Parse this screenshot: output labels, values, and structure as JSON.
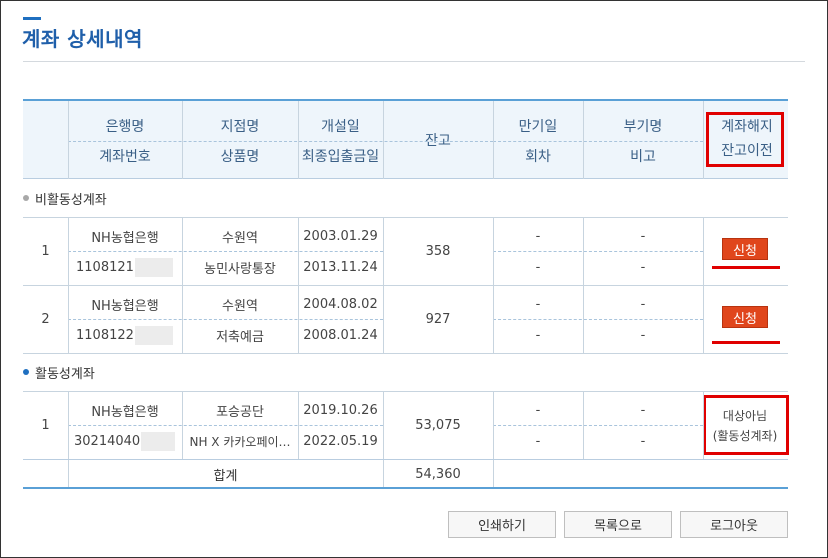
{
  "page": {
    "title": "계좌 상세내역"
  },
  "header": {
    "bank": "은행명",
    "account_no": "계좌번호",
    "branch": "지점명",
    "product": "상품명",
    "open_date": "개설일",
    "last_tx": "최종입출금일",
    "balance": "잔고",
    "maturity": "만기일",
    "round": "회차",
    "sub_name": "부기명",
    "remark": "비고",
    "action_line1": "계좌해지",
    "action_line2": "잔고이전"
  },
  "sections": {
    "inactive": {
      "label": "비활동성계좌",
      "color": "#a8a8a8"
    },
    "active": {
      "label": "활동성계좌",
      "color": "#1f6fc0"
    }
  },
  "rows": [
    {
      "no": "1",
      "bank": "NH농협은행",
      "account": "1108121",
      "branch": "수원역",
      "product": "농민사랑통장",
      "open_date": "2003.01.29",
      "last_tx": "2013.11.24",
      "balance": "358",
      "maturity": "-",
      "round": "-",
      "sub_name": "-",
      "remark": "-",
      "action": "신청"
    },
    {
      "no": "2",
      "bank": "NH농협은행",
      "account": "1108122",
      "branch": "수원역",
      "product": "저축예금",
      "open_date": "2004.08.02",
      "last_tx": "2008.01.24",
      "balance": "927",
      "maturity": "-",
      "round": "-",
      "sub_name": "-",
      "remark": "-",
      "action": "신청"
    },
    {
      "no": "1",
      "bank": "NH농협은행",
      "account": "30214040",
      "branch": "포승공단",
      "product": "NH X 카카오페이…",
      "open_date": "2019.10.26",
      "last_tx": "2022.05.19",
      "balance": "53,075",
      "maturity": "-",
      "round": "-",
      "sub_name": "-",
      "remark": "-",
      "action_line1": "대상아님",
      "action_line2": "(활동성계좌)"
    }
  ],
  "total": {
    "label": "합계",
    "value": "54,360"
  },
  "buttons": {
    "print": "인쇄하기",
    "list": "목록으로",
    "logout": "로그아웃"
  },
  "colors": {
    "accent": "#1f6fc0",
    "apply_button": "#e0461c",
    "highlight": "#e00000"
  }
}
